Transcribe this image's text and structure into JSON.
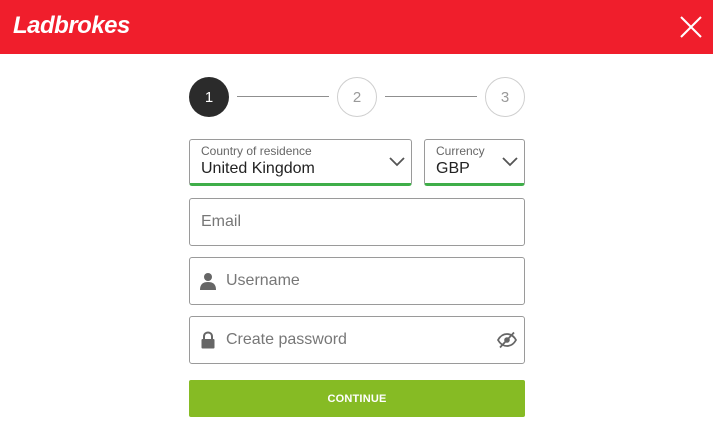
{
  "header": {
    "logo_text": "Ladbrokes",
    "brand_color": "#f01e2c",
    "close_icon": "close-icon"
  },
  "stepper": {
    "current_step": 1,
    "steps": [
      {
        "label": "1",
        "state": "active"
      },
      {
        "label": "2",
        "state": "inactive"
      },
      {
        "label": "3",
        "state": "inactive"
      }
    ]
  },
  "form": {
    "country": {
      "label": "Country of residence",
      "value": "United Kingdom",
      "icon": "chevron-down-icon"
    },
    "currency": {
      "label": "Currency",
      "value": "GBP",
      "icon": "chevron-down-icon"
    },
    "email": {
      "placeholder": "Email",
      "value": ""
    },
    "username": {
      "placeholder": "Username",
      "value": "",
      "icon": "user-icon"
    },
    "password": {
      "placeholder": "Create password",
      "value": "",
      "icon": "lock-icon",
      "toggle_icon": "eye-off-icon"
    },
    "valid_color": "#3fae49"
  },
  "continue_button": {
    "label": "CONTINUE",
    "color": "#86bb24"
  }
}
